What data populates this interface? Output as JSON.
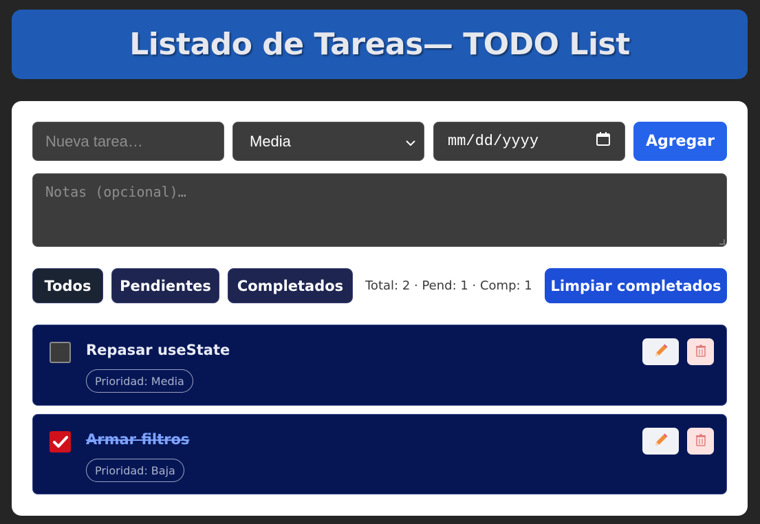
{
  "header": {
    "title": "Listado de Tareas— TODO List"
  },
  "form": {
    "task_placeholder": "Nueva tarea…",
    "priority_selected": "Media",
    "date_placeholder": "mm/dd/yyyy",
    "add_label": "Agregar",
    "notes_placeholder": "Notas (opcional)…"
  },
  "filters": {
    "all": "Todos",
    "pending": "Pendientes",
    "completed": "Completados",
    "counts": "Total: 2 · Pend: 1 · Comp: 1",
    "clear_label": "Limpiar completados"
  },
  "todos": [
    {
      "title": "Repasar useState",
      "priority_badge": "Prioridad: Media",
      "completed": false
    },
    {
      "title": "Armar filtros",
      "priority_badge": "Prioridad: Baja",
      "completed": true
    }
  ],
  "icons": {
    "edit": "pencil-icon",
    "delete": "trash-icon",
    "calendar": "calendar-icon",
    "dropdown": "chevron-down-icon",
    "check": "check-icon"
  },
  "colors": {
    "header_bg": "#1f5bb5",
    "primary_button": "#2563eb",
    "todo_bg": "#061655",
    "checked": "#d0111c"
  }
}
